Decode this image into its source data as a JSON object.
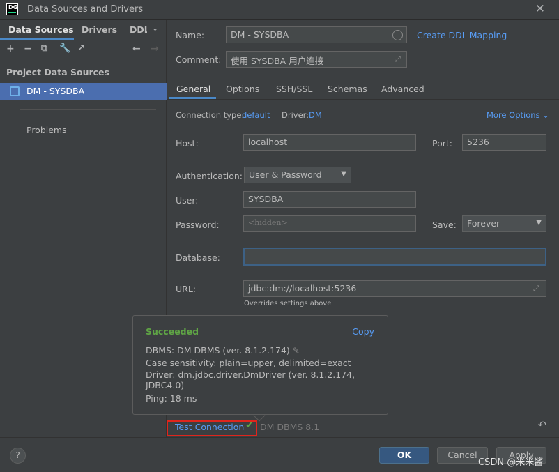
{
  "window": {
    "logo": "DG",
    "title": "Data Sources and Drivers",
    "close_icon": "close-icon"
  },
  "left": {
    "tabs": [
      "Data Sources",
      "Drivers",
      "DDL"
    ],
    "toolbar_icons": [
      "add-icon",
      "remove-icon",
      "duplicate-icon",
      "wrench-icon",
      "external-link-icon",
      "arrow-left-icon",
      "arrow-right-icon"
    ],
    "section_title": "Project Data Sources",
    "selected_item": "DM - SYSDBA",
    "problems_label": "Problems"
  },
  "form": {
    "name_label": "Name:",
    "name_value": "DM - SYSDBA",
    "create_ddl_link": "Create DDL Mapping",
    "comment_label": "Comment:",
    "comment_value": "使用 SYSDBA 用户连接",
    "tabs": [
      "General",
      "Options",
      "SSH/SSL",
      "Schemas",
      "Advanced"
    ],
    "active_tab": "General",
    "connection_type_label": "Connection type:",
    "connection_type_value": "default",
    "driver_label": "Driver:",
    "driver_value": "DM",
    "more_options": "More Options",
    "host_label": "Host:",
    "host_value": "localhost",
    "port_label": "Port:",
    "port_value": "5236",
    "auth_label": "Authentication:",
    "auth_value": "User & Password",
    "user_label": "User:",
    "user_value": "SYSDBA",
    "password_label": "Password:",
    "password_value": "<hidden>",
    "save_label": "Save:",
    "save_value": "Forever",
    "database_label": "Database:",
    "database_value": "",
    "url_label": "URL:",
    "url_value": "jdbc:dm://localhost:5236",
    "url_hint": "Overrides settings above"
  },
  "popup": {
    "title": "Succeeded",
    "copy_link": "Copy",
    "dbms": "DBMS: DM DBMS (ver. 8.1.2.174)",
    "case_sensitivity": "Case sensitivity: plain=upper, delimited=exact",
    "driver": "Driver: dm.jdbc.driver.DmDriver (ver. 8.1.2.174, JDBC4.0)",
    "ping": "Ping: 18 ms"
  },
  "status": {
    "test_connection": "Test Connection",
    "db_version": "DM DBMS 8.1"
  },
  "buttons": {
    "help": "?",
    "ok": "OK",
    "cancel": "Cancel",
    "apply": "Apply"
  },
  "watermark": "CSDN @米米酱",
  "colors": {
    "accent": "#589df6",
    "success": "#5fa445",
    "selection": "#4b6eaf",
    "highlight_box": "#e0251c"
  }
}
